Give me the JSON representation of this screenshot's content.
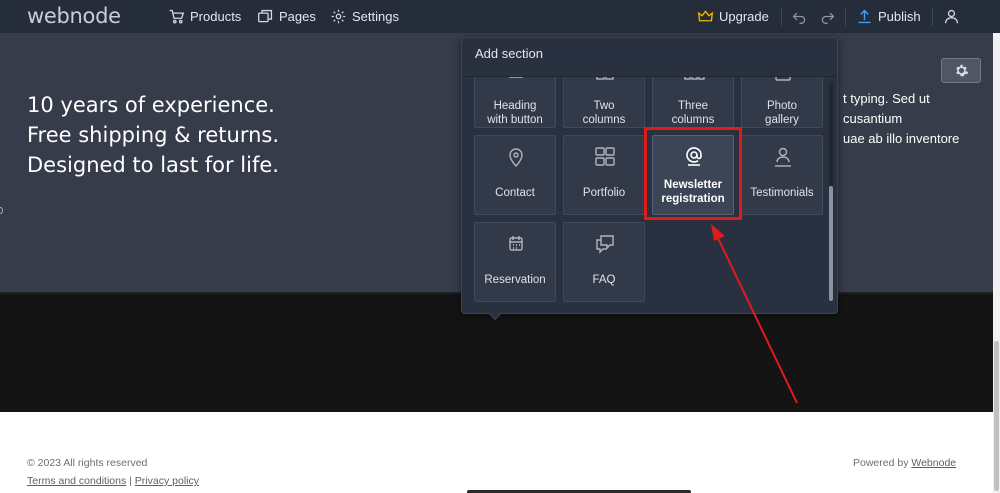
{
  "topbar": {
    "logo": "webnode",
    "products": "Products",
    "pages": "Pages",
    "settings": "Settings",
    "upgrade": "Upgrade",
    "publish": "Publish",
    "icons": {
      "products": "cart-icon",
      "pages": "pages-icon",
      "settings": "gear-icon",
      "upgrade": "crown-icon",
      "undo": "undo-icon",
      "redo": "redo-icon",
      "publish": "upload-icon",
      "account": "user-icon"
    },
    "colors": {
      "background": "#252c3a",
      "upgrade_icon": "#f2b705",
      "publish_icon": "#3aa0ff"
    }
  },
  "hero": {
    "lines": [
      "10 years of experience.",
      "Free shipping & returns.",
      "Designed to last for life."
    ],
    "right_text": [
      "t typing. Sed ut",
      "cusantium",
      "uae ab illo inventore"
    ],
    "background": "#363c4a"
  },
  "panel": {
    "title": "Add section",
    "tiles": [
      {
        "label": "Heading\nwith button",
        "icon": "heading-button-icon"
      },
      {
        "label": "Two\ncolumns",
        "icon": "two-columns-icon"
      },
      {
        "label": "Three\ncolumns",
        "icon": "three-columns-icon"
      },
      {
        "label": "Photo\ngallery",
        "icon": "photo-gallery-icon"
      },
      {
        "label": "Contact",
        "icon": "location-pin-icon"
      },
      {
        "label": "Portfolio",
        "icon": "grid-icon"
      },
      {
        "label": "Newsletter\nregistration",
        "icon": "at-sign-icon",
        "selected": true
      },
      {
        "label": "Testimonials",
        "icon": "person-icon"
      },
      {
        "label": "Reservation",
        "icon": "calendar-icon"
      },
      {
        "label": "FAQ",
        "icon": "chat-bubbles-icon"
      }
    ]
  },
  "annotation": {
    "highlight_color": "#e01b1b",
    "arrow_color": "#e01b1b"
  },
  "footer": {
    "copyright": "© 2023 All rights reserved",
    "terms": "Terms and conditions",
    "separator": "|",
    "privacy": "Privacy policy",
    "powered_prefix": "Powered by",
    "powered_link": "Webnode"
  }
}
